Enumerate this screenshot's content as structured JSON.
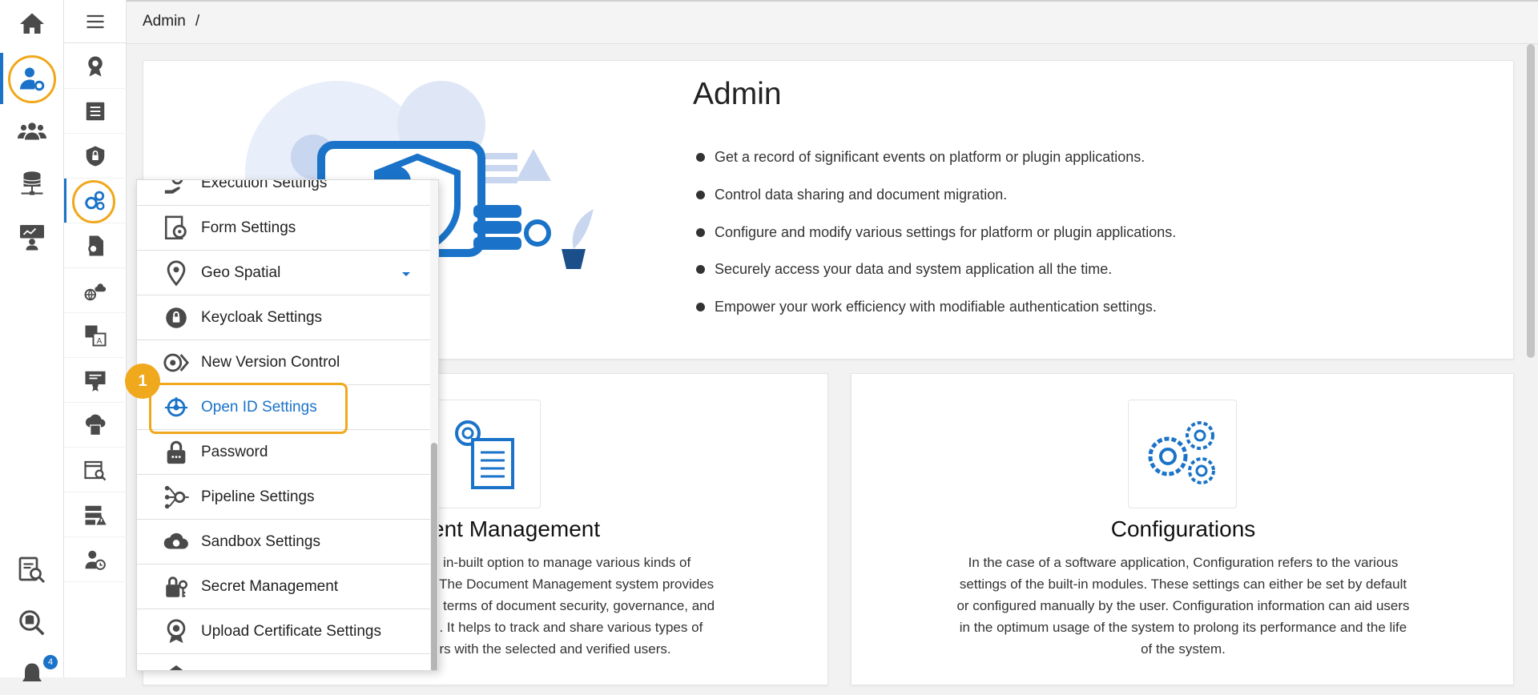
{
  "breadcrumb": {
    "root": "Admin",
    "separator": "/"
  },
  "hero": {
    "title": "Admin",
    "bullets": [
      "Get a record of significant events on platform or plugin applications.",
      "Control data sharing and document migration.",
      "Configure and modify various settings for platform or plugin applications.",
      "Securely access your data and system application all the time.",
      "Empower your work efficiency with modifiable authentication settings."
    ]
  },
  "cards": {
    "document": {
      "title": "ent Management",
      "desc": [
        "n in-built option to manage various kinds of",
        ". The Document Management system provides",
        "n terms of document security, governance, and",
        "e. It helps to track and share various types of",
        "ers with the selected and verified users."
      ]
    },
    "configurations": {
      "title": "Configurations",
      "desc": [
        "In the case of a software application, Configuration refers to the various",
        "settings of the built-in modules. These settings can either be set by default",
        "or configured manually by the user. Configuration information can aid users",
        "in the optimum usage of the system to prolong its performance and the life",
        "of the system."
      ]
    }
  },
  "menu": {
    "items": [
      "Execution Settings",
      "Form Settings",
      "Geo Spatial",
      "Keycloak Settings",
      "New Version Control",
      "Open ID Settings",
      "Password",
      "Pipeline Settings",
      "Sandbox Settings",
      "Secret Management",
      "Upload Certificate Settings"
    ],
    "selected": "Open ID Settings"
  },
  "step_badge": "1",
  "notification_count": "4",
  "colors": {
    "accent": "#1a73c8",
    "highlight": "#f0a81c",
    "icon": "#4a4a4a"
  }
}
